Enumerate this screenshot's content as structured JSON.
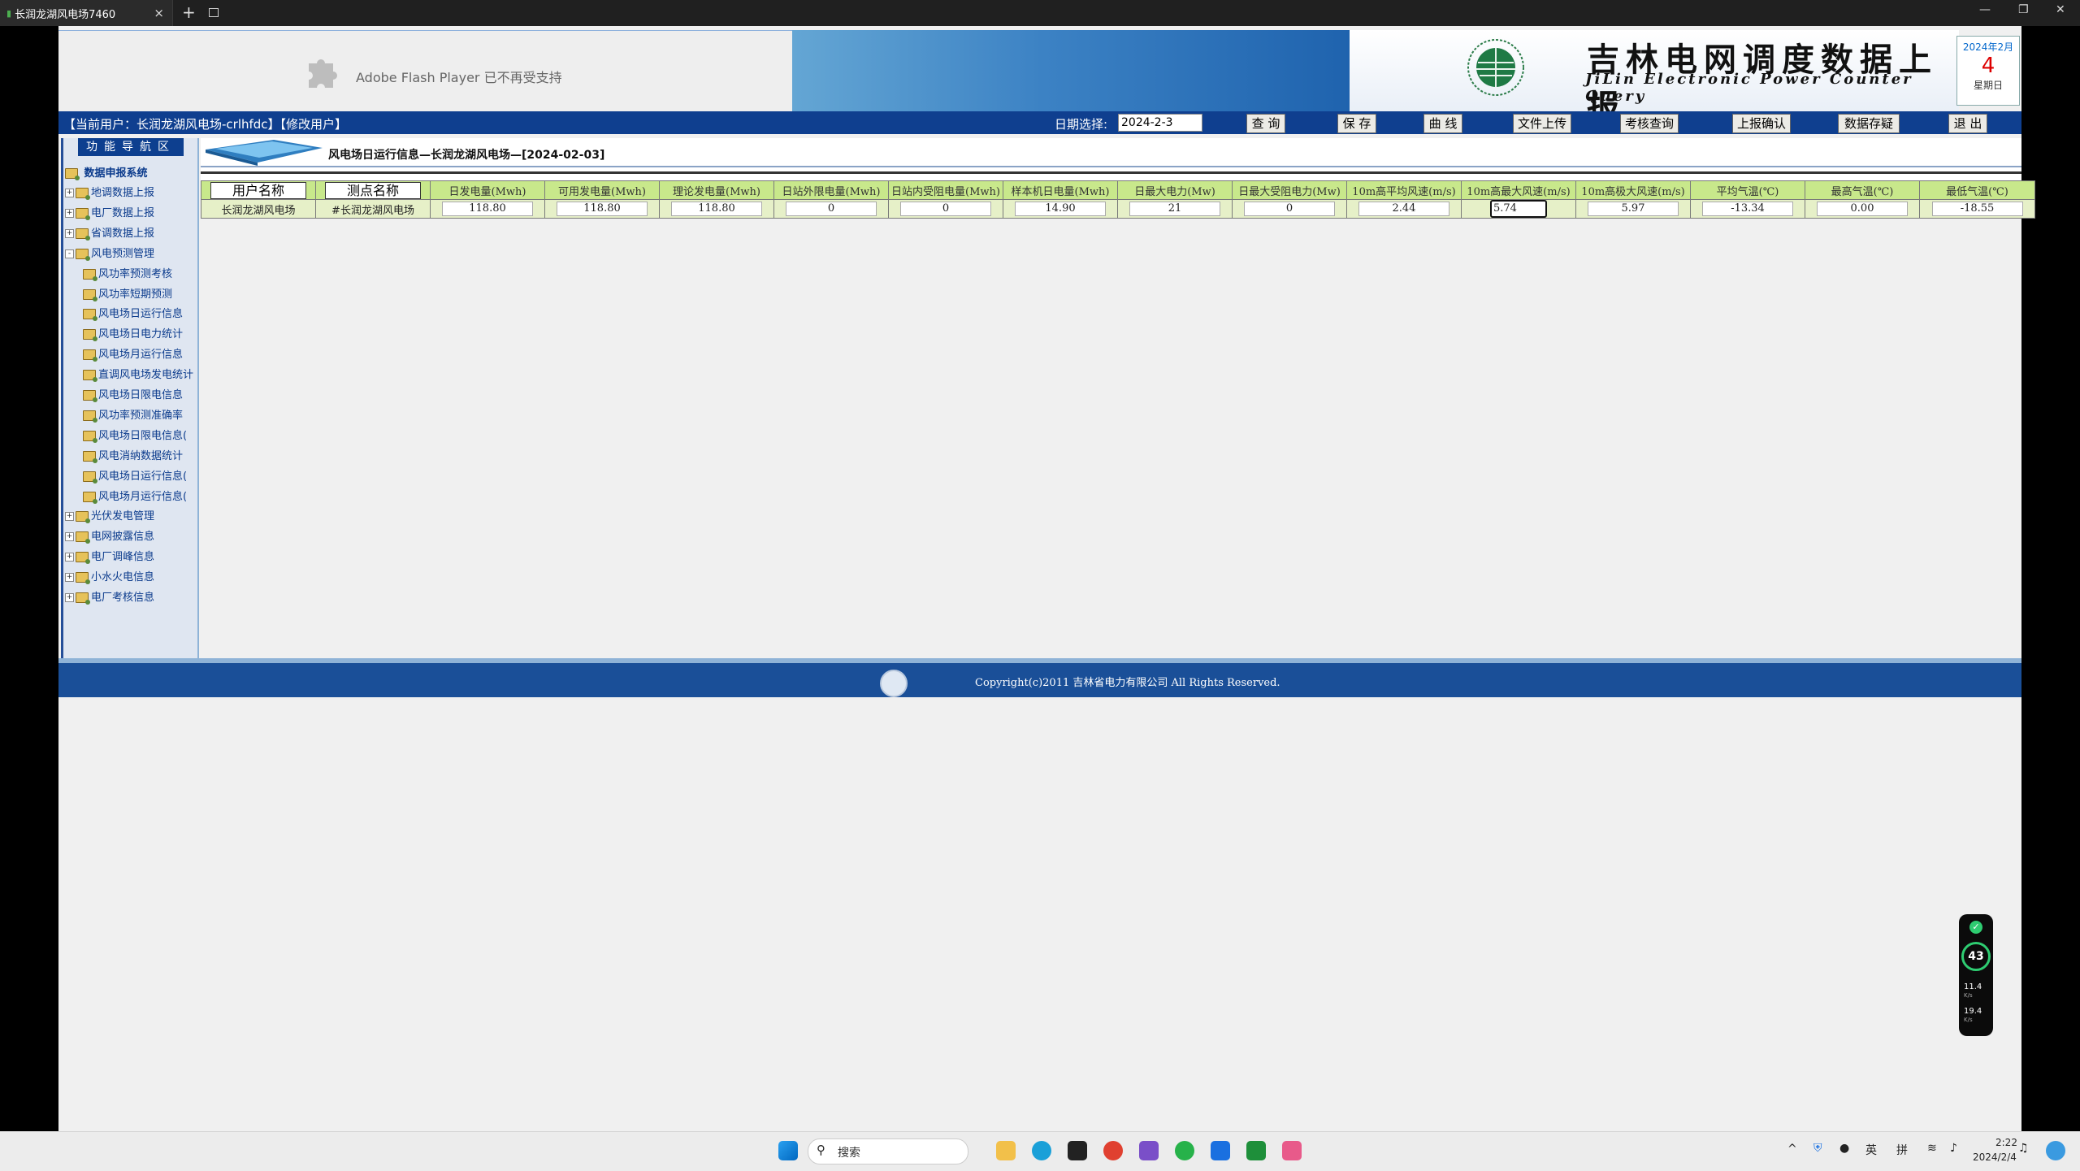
{
  "browser": {
    "tab_title": "长润龙湖风电场7460",
    "tab_close": "×",
    "new_tab": "+",
    "win_minimize": "—",
    "win_restore": "❐",
    "win_close": "✕"
  },
  "banner": {
    "flash_text": "Adobe Flash Player 已不再受支持",
    "title_cn": "吉林电网调度数据上报",
    "title_en": "JiLin Electronic Power Counter Query",
    "date_year_month": "2024年2月",
    "date_day": "4",
    "date_weekday": "星期日"
  },
  "menubar": {
    "current_user": "【当前用户：长润龙湖风电场-crlhfdc】【修改用户】",
    "date_label": "日期选择:",
    "date_value": "2024-2-3",
    "buttons": [
      "查 询",
      "保 存",
      "曲 线",
      "文件上传",
      "考核查询",
      "上报确认",
      "数据存疑",
      "退 出"
    ]
  },
  "sidebar": {
    "title": "功能导航区",
    "root": "数据申报系统",
    "items": [
      {
        "label": "地调数据上报",
        "level": 1,
        "expander": "+"
      },
      {
        "label": "电厂数据上报",
        "level": 1,
        "expander": "+"
      },
      {
        "label": "省调数据上报",
        "level": 1,
        "expander": "+"
      },
      {
        "label": "风电预测管理",
        "level": 1,
        "expander": "-"
      },
      {
        "label": "风功率预测考核",
        "level": 2,
        "expander": ""
      },
      {
        "label": "风功率短期预测",
        "level": 2,
        "expander": ""
      },
      {
        "label": "风电场日运行信息",
        "level": 2,
        "expander": ""
      },
      {
        "label": "风电场日电力统计",
        "level": 2,
        "expander": ""
      },
      {
        "label": "风电场月运行信息",
        "level": 2,
        "expander": ""
      },
      {
        "label": "直调风电场发电统计",
        "level": 2,
        "expander": ""
      },
      {
        "label": "风电场日限电信息",
        "level": 2,
        "expander": ""
      },
      {
        "label": "风功率预测准确率",
        "level": 2,
        "expander": ""
      },
      {
        "label": "风电场日限电信息(",
        "level": 2,
        "expander": ""
      },
      {
        "label": "风电消纳数据统计",
        "level": 2,
        "expander": ""
      },
      {
        "label": "风电场日运行信息(",
        "level": 2,
        "expander": ""
      },
      {
        "label": "风电场月运行信息(",
        "level": 2,
        "expander": ""
      },
      {
        "label": "光伏发电管理",
        "level": 1,
        "expander": "+"
      },
      {
        "label": "电网披露信息",
        "level": 1,
        "expander": "+"
      },
      {
        "label": "电厂调峰信息",
        "level": 1,
        "expander": "+"
      },
      {
        "label": "小水火电信息",
        "level": 1,
        "expander": "+"
      },
      {
        "label": "电厂考核信息",
        "level": 1,
        "expander": "+"
      }
    ]
  },
  "content": {
    "title": "风电场日运行信息—长润龙湖风电场—[2024-02-03]",
    "table": {
      "headers": [
        "用户名称",
        "测点名称",
        "日发电量(Mwh)",
        "可用发电量(Mwh)",
        "理论发电量(Mwh)",
        "日站外限电量(Mwh)",
        "日站内受阻电量(Mwh)",
        "样本机日电量(Mwh)",
        "日最大电力(Mw)",
        "日最大受阻电力(Mw)",
        "10m高平均风速(m/s)",
        "10m高最大风速(m/s)",
        "10m高极大风速(m/s)",
        "平均气温(℃)",
        "最高气温(℃)",
        "最低气温(℃)"
      ],
      "row": [
        "长润龙湖风电场",
        "#长润龙湖风电场",
        "118.80",
        "118.80",
        "118.80",
        "0",
        "0",
        "14.90",
        "21",
        "0",
        "2.44",
        "5.74",
        "5.97",
        "-13.34",
        "0.00",
        "-18.55"
      ]
    }
  },
  "footer": {
    "copyright": "Copyright(c)2011 吉林省电力有限公司 All Rights Reserved."
  },
  "widget": {
    "percent": "43",
    "up_speed": "11.4",
    "down_speed": "19.4",
    "unit": "K/s"
  },
  "taskbar": {
    "search_placeholder": "搜索",
    "ime1": "英",
    "ime2": "拼",
    "time": "2:22",
    "date": "2024/2/4"
  },
  "colors": {
    "header_blue": "#0f3f8f",
    "table_header_green": "#c8e88b",
    "footer_blue": "#1a4f98"
  }
}
